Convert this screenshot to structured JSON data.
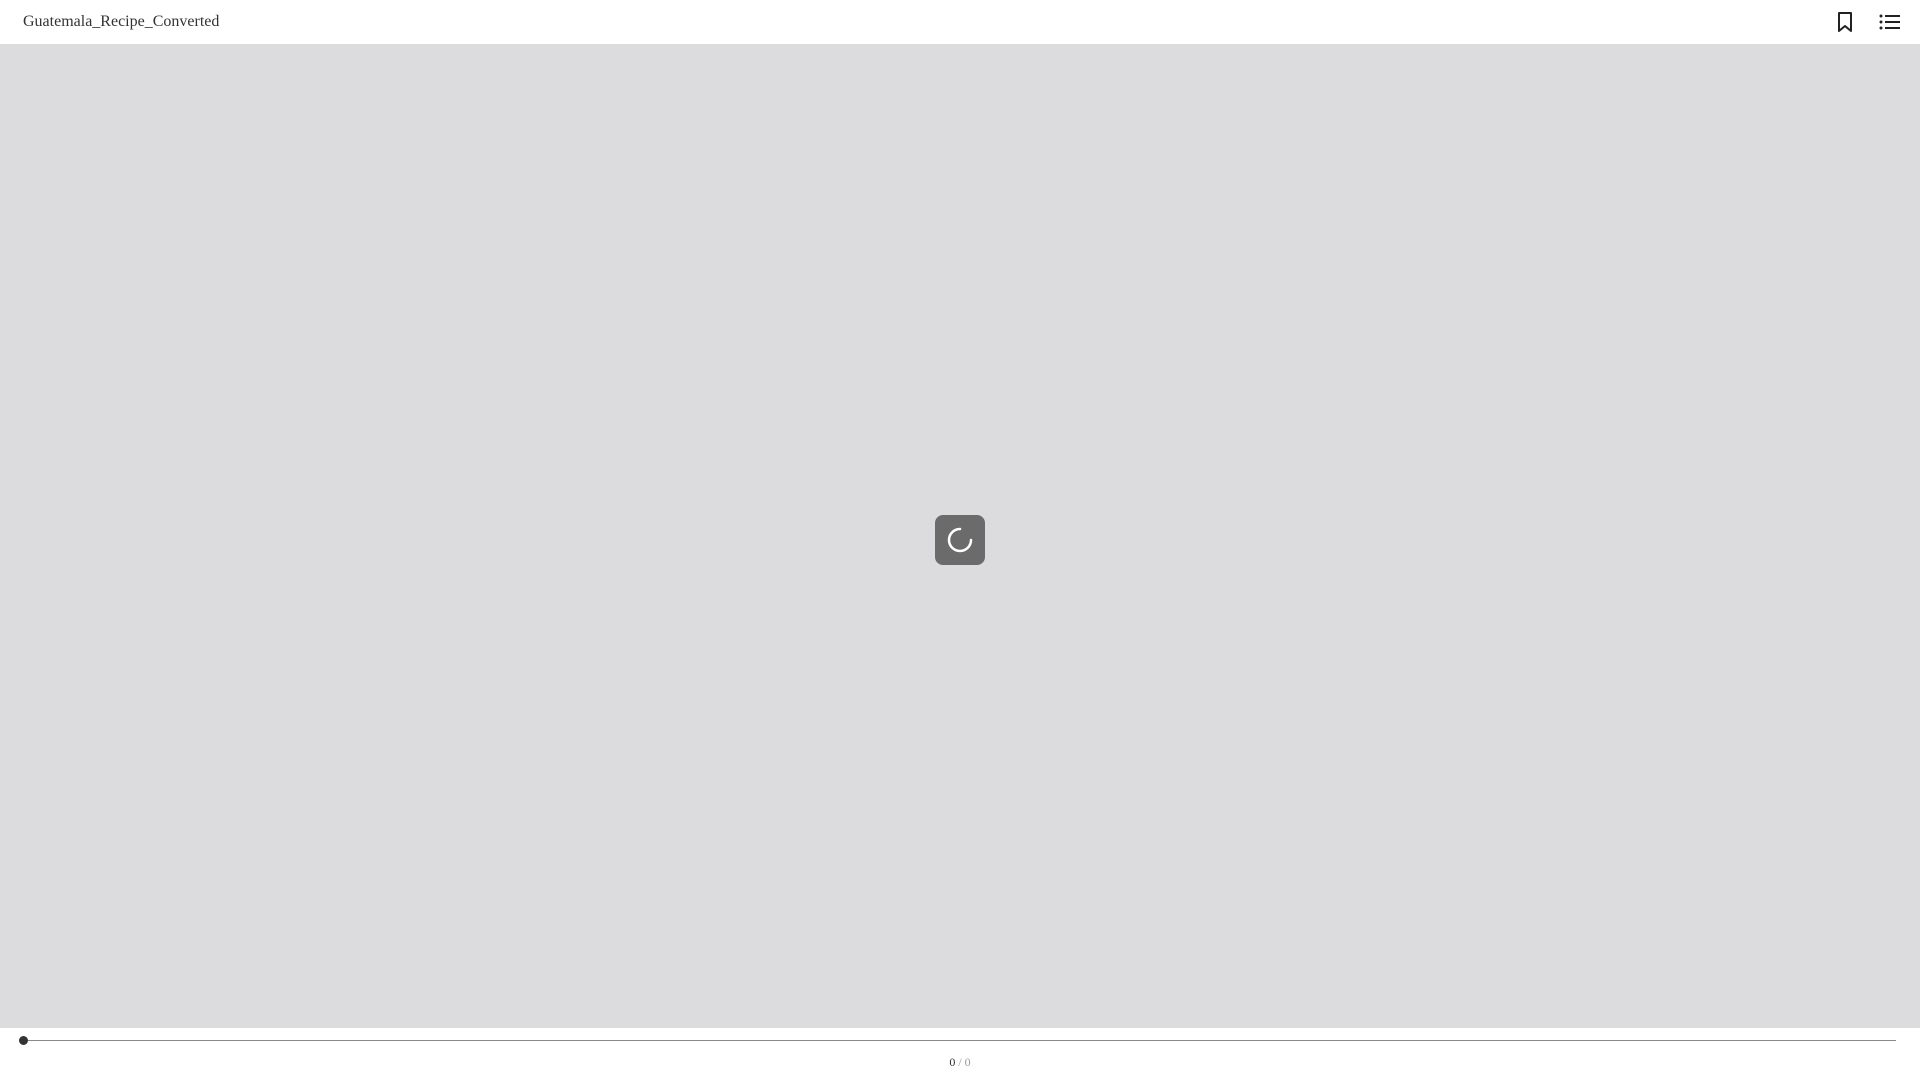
{
  "header": {
    "title": "Guatemala_Recipe_Converted",
    "bookmark_icon": "bookmark-icon",
    "toc_icon": "list-icon"
  },
  "viewer": {
    "background": "#dcdcde",
    "loading_icon": "spinner-icon"
  },
  "footer": {
    "progress": 0,
    "page_current": "0",
    "page_separator": " / ",
    "page_total": "0"
  }
}
